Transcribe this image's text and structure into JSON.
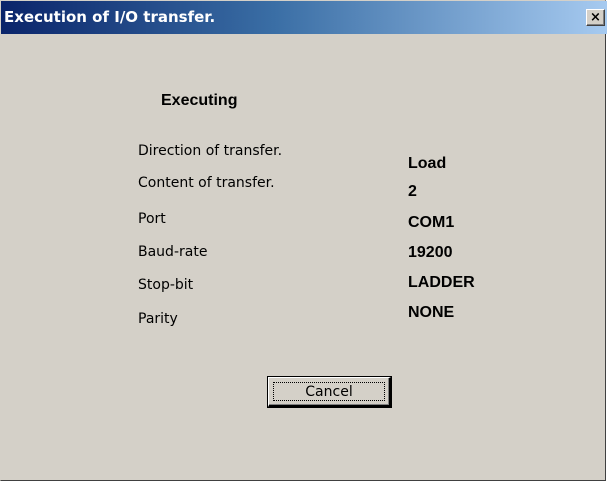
{
  "window": {
    "title": "Execution of I/O transfer.",
    "close_glyph": "×"
  },
  "status": {
    "heading": "Executing"
  },
  "fields": [
    {
      "label": "Direction of transfer.",
      "value": "Load"
    },
    {
      "label": "Content of transfer.",
      "value": "2"
    },
    {
      "label": "Port",
      "value": "COM1"
    },
    {
      "label": "Baud-rate",
      "value": "19200"
    },
    {
      "label": "Stop-bit",
      "value": "LADDER"
    },
    {
      "label": "Parity",
      "value": "NONE"
    }
  ],
  "buttons": {
    "cancel_label": "Cancel"
  },
  "colors": {
    "dialog_background": "#d4d0c8",
    "titlebar_start": "#0a246a",
    "titlebar_end": "#a6caf0",
    "title_text": "#ffffff"
  },
  "icons": {
    "close": "close-icon"
  }
}
